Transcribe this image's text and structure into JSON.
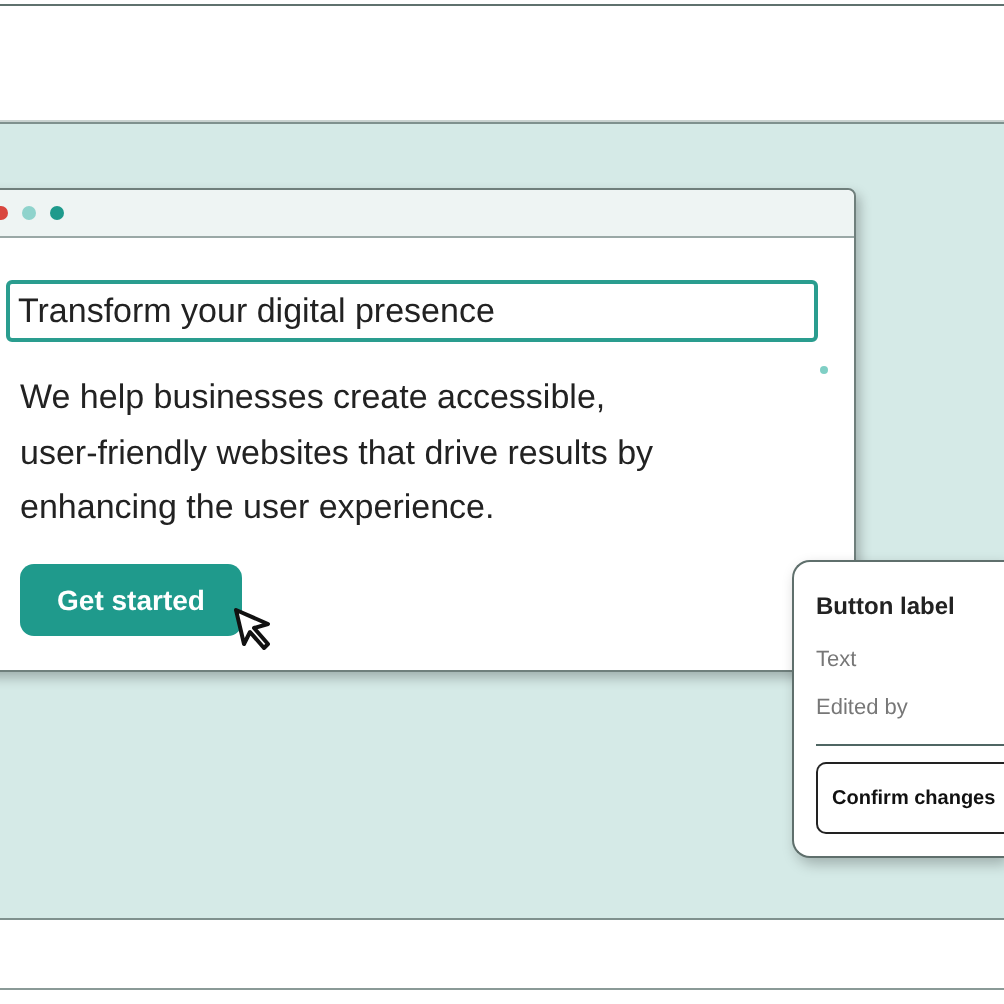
{
  "browser": {
    "dots": [
      {
        "color": "#d9463e"
      },
      {
        "color": "#8fd3cc"
      },
      {
        "color": "#1e9a8c"
      }
    ],
    "headline_field": {
      "value": "Transform your digital presence"
    },
    "description": "We help businesses create accessible,\nuser-friendly websites that drive results by\nenhancing the user experience.",
    "button": "Get started"
  },
  "popup": {
    "title": "Button label",
    "fields": [
      "Text",
      "Edited by"
    ],
    "button": "Confirm changes"
  }
}
